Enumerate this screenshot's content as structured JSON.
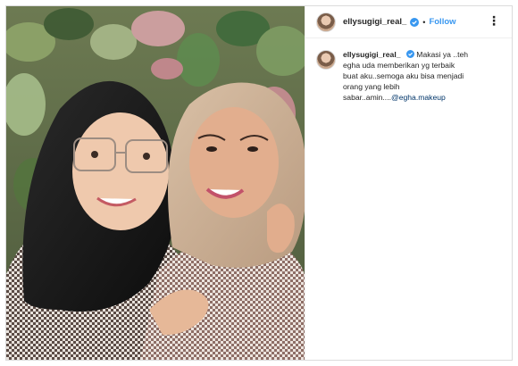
{
  "post": {
    "username": "ellysugigi_real_",
    "separator": "•",
    "follow_label": "Follow",
    "more_label": "⋮"
  },
  "caption": {
    "username": "ellysugigi_real_",
    "text": "Makasi ya ..teh\negha uda memberikan yg terbaik\nbuat aku..semoga aku bisa menjadi\norang yang lebih\nsabar..amin....",
    "mention": "@egha.makeup"
  },
  "colors": {
    "accent": "#3897f0",
    "verified": "#3897f0",
    "mention": "#003569"
  },
  "icons": {
    "verified": "verified-badge-icon",
    "more": "more-options-icon"
  }
}
